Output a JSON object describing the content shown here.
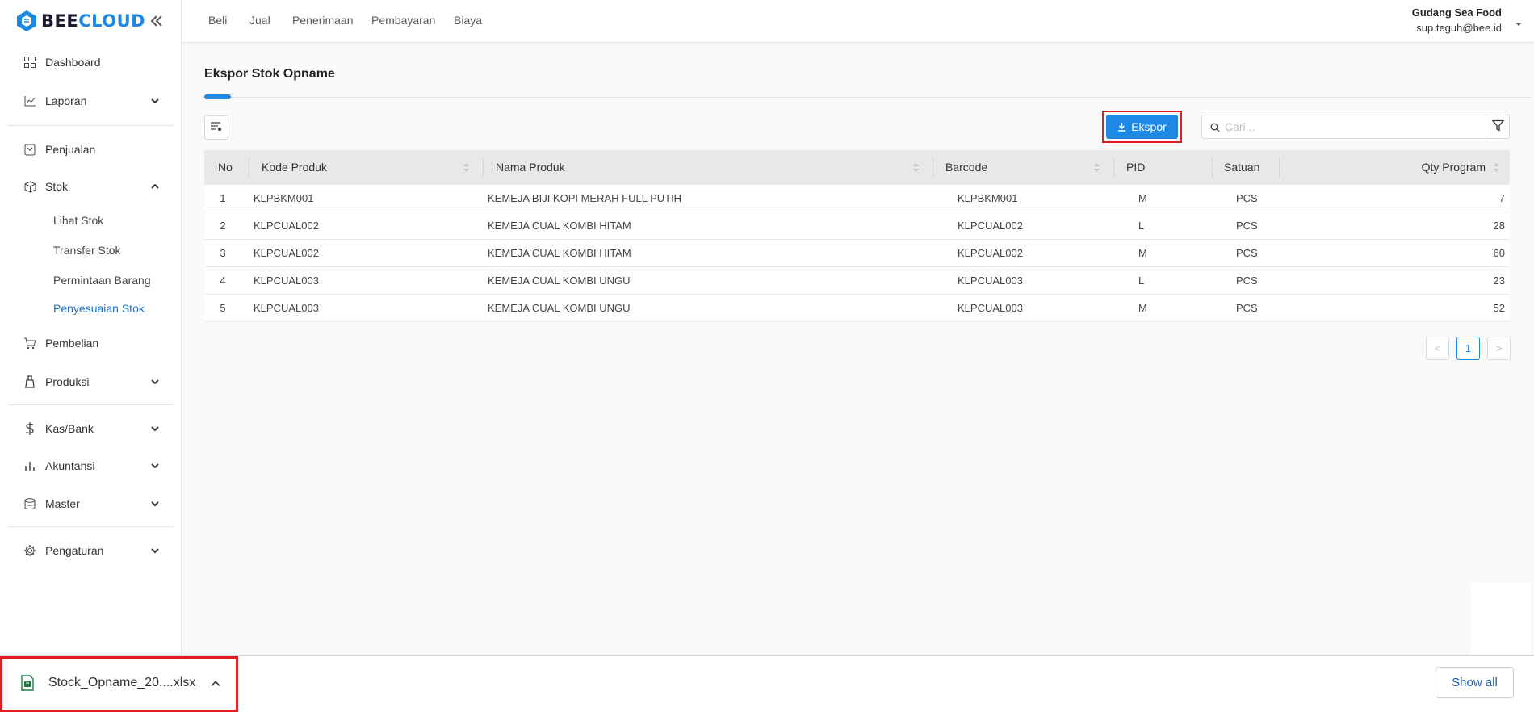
{
  "brand": {
    "bee": "BEE",
    "cloud": "CLOUD"
  },
  "sidebar": {
    "items": [
      {
        "key": "dashboard",
        "label": "Dashboard",
        "icon": "grid-icon"
      },
      {
        "key": "laporan",
        "label": "Laporan",
        "icon": "chart-line-icon",
        "expandable": true
      },
      {
        "key": "penjualan",
        "label": "Penjualan",
        "icon": "receipt-icon"
      },
      {
        "key": "stok",
        "label": "Stok",
        "icon": "box-icon",
        "expanded": true
      },
      {
        "key": "pembelian",
        "label": "Pembelian",
        "icon": "cart-icon"
      },
      {
        "key": "produksi",
        "label": "Produksi",
        "icon": "factory-icon",
        "expandable": true
      },
      {
        "key": "kasbank",
        "label": "Kas/Bank",
        "icon": "dollar-icon",
        "expandable": true
      },
      {
        "key": "akuntansi",
        "label": "Akuntansi",
        "icon": "bar-chart-icon",
        "expandable": true
      },
      {
        "key": "master",
        "label": "Master",
        "icon": "database-icon",
        "expandable": true
      },
      {
        "key": "pengaturan",
        "label": "Pengaturan",
        "icon": "gear-icon",
        "expandable": true
      }
    ],
    "stok_sub": [
      "Lihat Stok",
      "Transfer Stok",
      "Permintaan Barang",
      "Penyesuaian Stok"
    ],
    "active_sub": "Penyesuaian Stok"
  },
  "topbar": {
    "menu": [
      "Beli",
      "Jual",
      "Penerimaan",
      "Pembayaran",
      "Biaya"
    ],
    "user_name": "Gudang Sea Food",
    "user_email": "sup.teguh@bee.id"
  },
  "page": {
    "title": "Ekspor Stok Opname",
    "export_label": "Ekspor",
    "search_placeholder": "Cari..."
  },
  "table": {
    "headers": [
      "No",
      "Kode Produk",
      "Nama Produk",
      "Barcode",
      "PID",
      "Satuan",
      "Qty Program"
    ],
    "rows": [
      [
        "1",
        "KLPBKM001",
        "KEMEJA BIJI KOPI MERAH FULL PUTIH",
        "KLPBKM001",
        "M",
        "PCS",
        "7"
      ],
      [
        "2",
        "KLPCUAL002",
        "KEMEJA CUAL KOMBI HITAM",
        "KLPCUAL002",
        "L",
        "PCS",
        "28"
      ],
      [
        "3",
        "KLPCUAL002",
        "KEMEJA CUAL KOMBI HITAM",
        "KLPCUAL002",
        "M",
        "PCS",
        "60"
      ],
      [
        "4",
        "KLPCUAL003",
        "KEMEJA CUAL KOMBI UNGU",
        "KLPCUAL003",
        "L",
        "PCS",
        "23"
      ],
      [
        "5",
        "KLPCUAL003",
        "KEMEJA CUAL KOMBI UNGU",
        "KLPCUAL003",
        "M",
        "PCS",
        "52"
      ]
    ]
  },
  "pagination": {
    "prev": "<",
    "current": "1",
    "next": ">"
  },
  "download_bar": {
    "file_name": "Stock_Opname_20....xlsx",
    "show_all": "Show all"
  },
  "colors": {
    "accent": "#1e88e5",
    "highlight": "#e31b23",
    "excel_green": "#1e7e45"
  }
}
